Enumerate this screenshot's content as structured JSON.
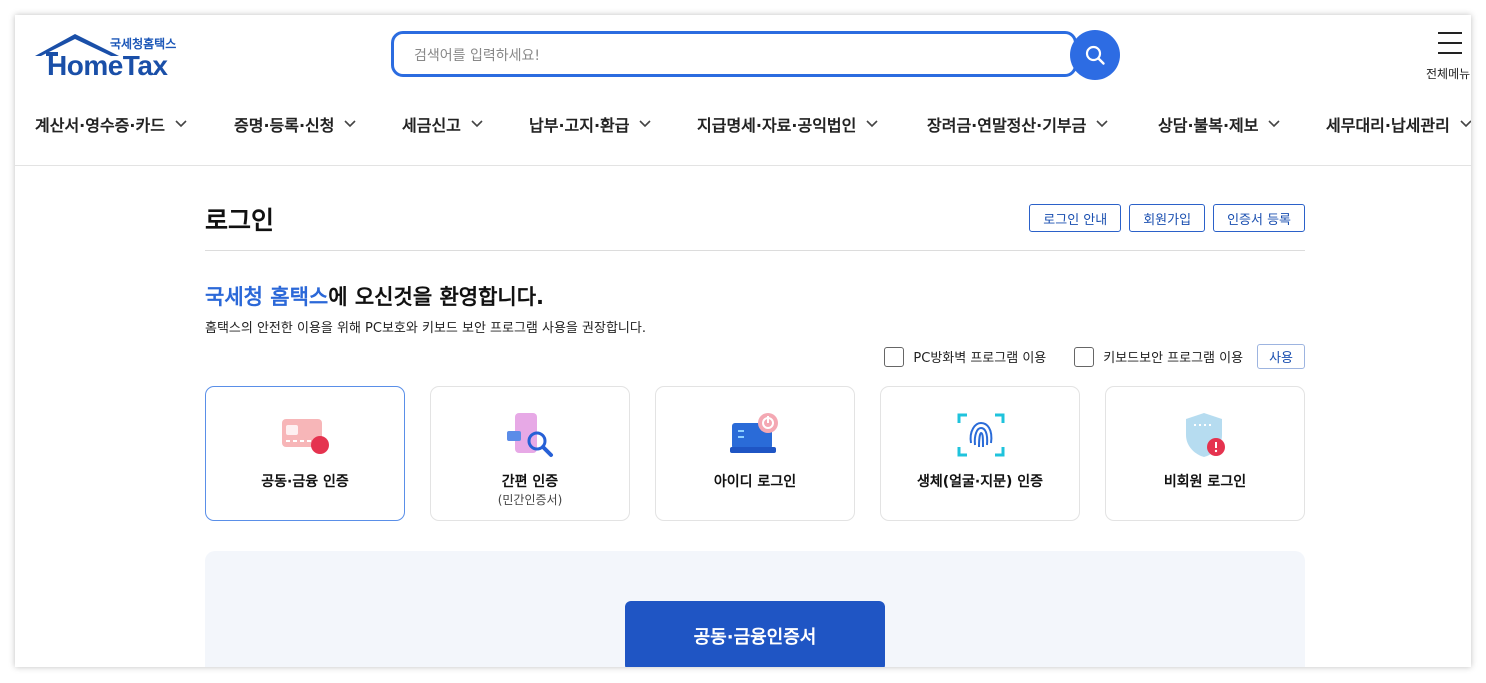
{
  "logo": {
    "korean": "국세청홈택스",
    "english": "HomeTax"
  },
  "search": {
    "placeholder": "검색어를 입력하세요!"
  },
  "all_menu": {
    "label": "전체메뉴"
  },
  "gnb": [
    {
      "label": "계산서·영수증·카드"
    },
    {
      "label": "증명·등록·신청"
    },
    {
      "label": "세금신고"
    },
    {
      "label": "납부·고지·환급"
    },
    {
      "label": "지급명세·자료·공익법인"
    },
    {
      "label": "장려금·연말정산·기부금"
    },
    {
      "label": "상담·불복·제보"
    },
    {
      "label": "세무대리·납세관리"
    }
  ],
  "page": {
    "title": "로그인",
    "buttons": {
      "login_guide": "로그인 안내",
      "signup": "회원가입",
      "cert_register": "인증서 등록"
    },
    "welcome": {
      "highlight": "국세청 홈택스",
      "rest": "에 오신것을 환영합니다."
    },
    "description": "홈택스의 안전한 이용을 위해 PC보호와 키보드 보안 프로그램 사용을 권장합니다.",
    "options": {
      "firewall": "PC방화벽 프로그램 이용",
      "keyboard": "키보드보안 프로그램 이용",
      "use_button": "사용"
    }
  },
  "login_methods": [
    {
      "label": "공동·금융 인증",
      "sub": "",
      "icon": "certificate-card-icon",
      "active": true
    },
    {
      "label": "간편 인증",
      "sub": "(민간인증서)",
      "icon": "phone-search-icon",
      "active": false
    },
    {
      "label": "아이디 로그인",
      "sub": "",
      "icon": "laptop-power-icon",
      "active": false
    },
    {
      "label": "생체(얼굴·지문) 인증",
      "sub": "",
      "icon": "fingerprint-icon",
      "active": false
    },
    {
      "label": "비회원 로그인",
      "sub": "",
      "icon": "shield-icon",
      "active": false
    }
  ],
  "panel": {
    "cert_button": "공동·금융인증서"
  },
  "colors": {
    "brand": "#1a4fa8",
    "accent": "#2b6ce0",
    "primary_button": "#1f55c4",
    "panel_bg": "#f3f6fb"
  }
}
